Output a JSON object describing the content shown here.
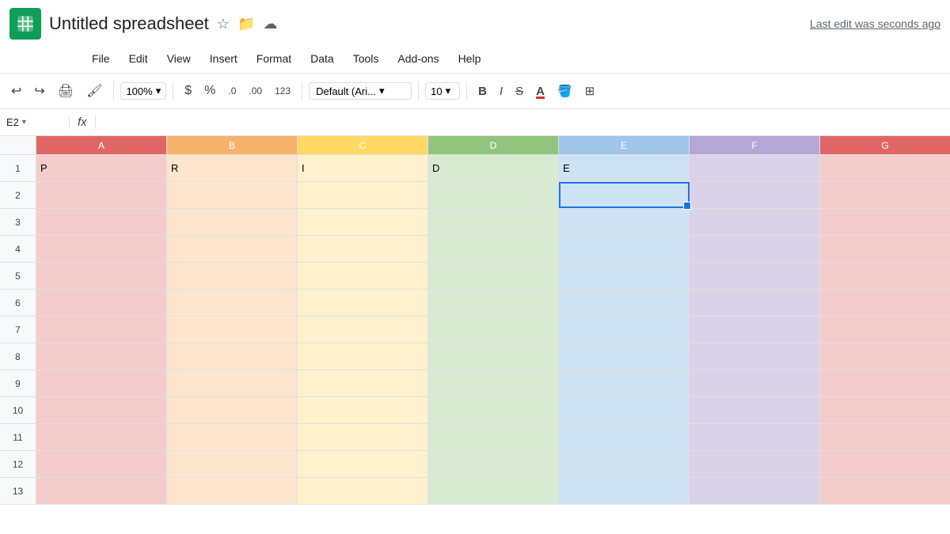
{
  "title": {
    "app_name": "Untitled spreadsheet",
    "last_edit": "Last edit was seconds ago"
  },
  "menu": {
    "items": [
      "File",
      "Edit",
      "View",
      "Insert",
      "Format",
      "Data",
      "Tools",
      "Add-ons",
      "Help"
    ]
  },
  "toolbar": {
    "zoom": "100%",
    "currency": "$",
    "percent": "%",
    "decimal_less": ".0",
    "decimal_more": ".00",
    "format_number": "123",
    "font": "Default (Ari...",
    "font_size": "10",
    "bold": "B",
    "italic": "I",
    "strikethrough": "S"
  },
  "formula_bar": {
    "cell_ref": "E2",
    "fx": "fx"
  },
  "columns": {
    "headers": [
      "A",
      "B",
      "C",
      "D",
      "E",
      "F",
      "G"
    ],
    "widths": [
      165,
      165,
      165,
      165,
      165,
      165,
      165
    ]
  },
  "rows": {
    "count": 13,
    "data": [
      {
        "num": 1,
        "cells": [
          "P",
          "R",
          "I",
          "D",
          "E",
          "",
          ""
        ]
      },
      {
        "num": 2,
        "cells": [
          "",
          "",
          "",
          "",
          "",
          "",
          ""
        ]
      },
      {
        "num": 3,
        "cells": [
          "",
          "",
          "",
          "",
          "",
          "",
          ""
        ]
      },
      {
        "num": 4,
        "cells": [
          "",
          "",
          "",
          "",
          "",
          "",
          ""
        ]
      },
      {
        "num": 5,
        "cells": [
          "",
          "",
          "",
          "",
          "",
          "",
          ""
        ]
      },
      {
        "num": 6,
        "cells": [
          "",
          "",
          "",
          "",
          "",
          "",
          ""
        ]
      },
      {
        "num": 7,
        "cells": [
          "",
          "",
          "",
          "",
          "",
          "",
          ""
        ]
      },
      {
        "num": 8,
        "cells": [
          "",
          "",
          "",
          "",
          "",
          "",
          ""
        ]
      },
      {
        "num": 9,
        "cells": [
          "",
          "",
          "",
          "",
          "",
          "",
          ""
        ]
      },
      {
        "num": 10,
        "cells": [
          "",
          "",
          "",
          "",
          "",
          "",
          ""
        ]
      },
      {
        "num": 11,
        "cells": [
          "",
          "",
          "",
          "",
          "",
          "",
          ""
        ]
      },
      {
        "num": 12,
        "cells": [
          "",
          "",
          "",
          "",
          "",
          "",
          ""
        ]
      },
      {
        "num": 13,
        "cells": [
          "",
          "",
          "",
          "",
          "",
          "",
          ""
        ]
      }
    ]
  },
  "selected_cell": {
    "row": 2,
    "col": 4
  }
}
